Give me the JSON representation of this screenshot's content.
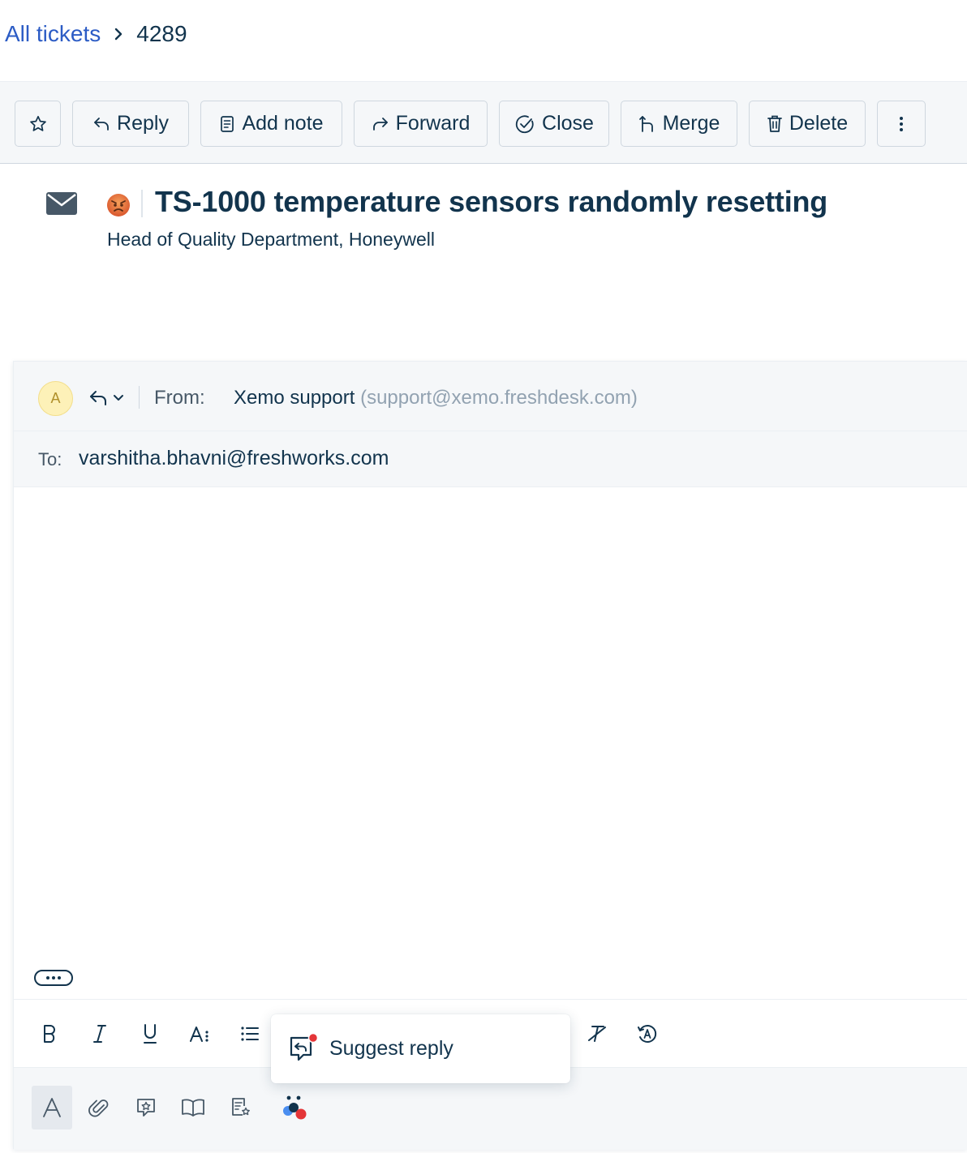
{
  "breadcrumb": {
    "all_tickets": "All tickets",
    "ticket_id": "4289"
  },
  "toolbar": {
    "reply": "Reply",
    "add_note": "Add note",
    "forward": "Forward",
    "close": "Close",
    "merge": "Merge",
    "delete": "Delete"
  },
  "ticket": {
    "title": "TS-1000 temperature sensors randomly resetting",
    "subtitle": "Head of Quality Department, Honeywell",
    "sentiment_icon": "angry-face-emoji"
  },
  "reply": {
    "avatar_initial": "A",
    "from_label": "From:",
    "from_name": "Xemo support",
    "from_email": "(support@xemo.freshdesk.com)",
    "to_label": "To:",
    "to_value": "varshitha.bhavni@freshworks.com"
  },
  "popup": {
    "suggest_reply": "Suggest reply"
  },
  "colors": {
    "link": "#2c5cc5",
    "text": "#12344d",
    "muted": "#92a2b1",
    "band": "#f5f7f9",
    "border": "#cfd7df",
    "notification_dot": "#e43538"
  }
}
